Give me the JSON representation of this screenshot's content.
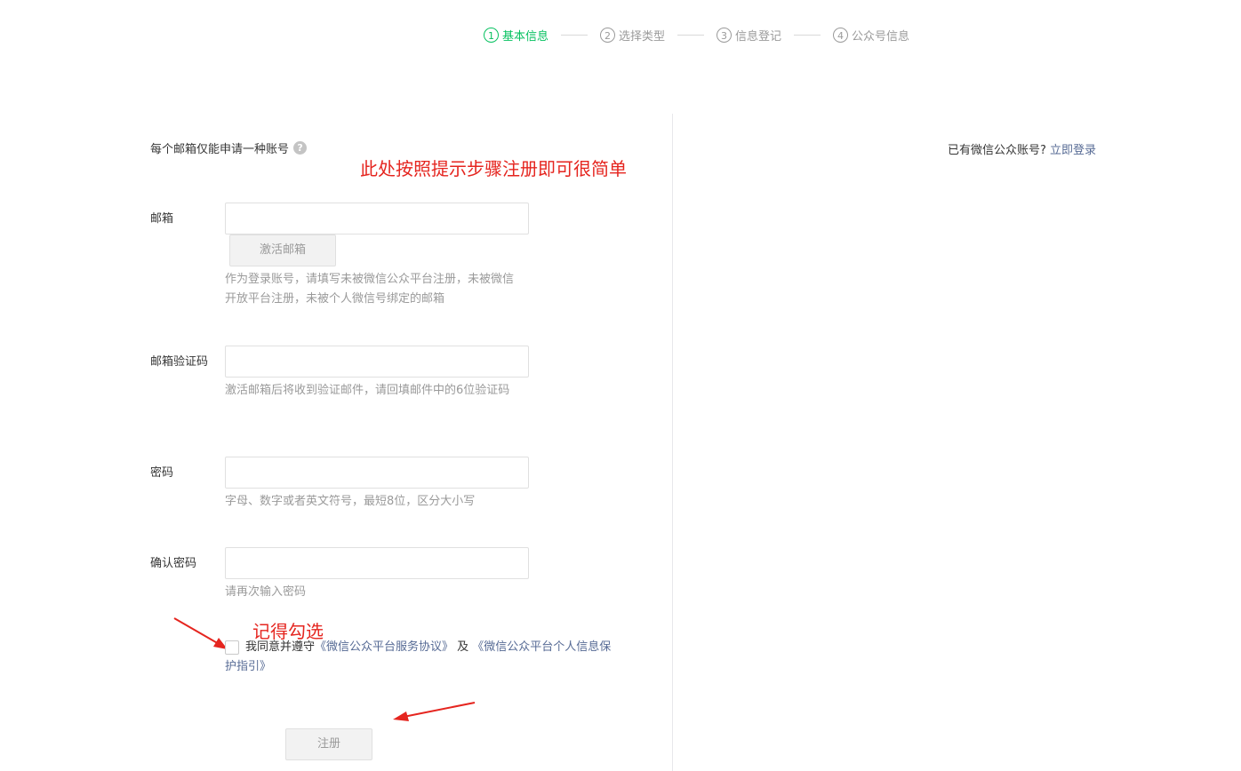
{
  "steps": [
    {
      "num": "1",
      "label": "基本信息",
      "active": true
    },
    {
      "num": "2",
      "label": "选择类型",
      "active": false
    },
    {
      "num": "3",
      "label": "信息登记",
      "active": false
    },
    {
      "num": "4",
      "label": "公众号信息",
      "active": false
    }
  ],
  "form": {
    "notice": "每个邮箱仅能申请一种账号",
    "email_label": "邮箱",
    "email_value": "",
    "activate_button": "激活邮箱",
    "email_tip": "作为登录账号，请填写未被微信公众平台注册，未被微信开放平台注册，未被个人微信号绑定的邮箱",
    "code_label": "邮箱验证码",
    "code_value": "",
    "code_tip": "激活邮箱后将收到验证邮件，请回填邮件中的6位验证码",
    "password_label": "密码",
    "password_value": "",
    "password_tip": "字母、数字或者英文符号，最短8位，区分大小写",
    "confirm_label": "确认密码",
    "confirm_value": "",
    "confirm_tip": "请再次输入密码",
    "agree_prefix": "我同意并遵守",
    "agree_link1": "《微信公众平台服务协议》",
    "agree_and": " 及 ",
    "agree_link2": "《微信公众平台个人信息保护指引》",
    "register_button": "注册"
  },
  "side": {
    "login_prompt": "已有微信公众账号?",
    "login_link": "立即登录"
  },
  "annotations": {
    "top": "此处按照提示步骤注册即可很简单",
    "checkbox": "记得勾选"
  },
  "colors": {
    "accent": "#07c160",
    "link": "#576b95",
    "annotation": "#e5251f"
  }
}
